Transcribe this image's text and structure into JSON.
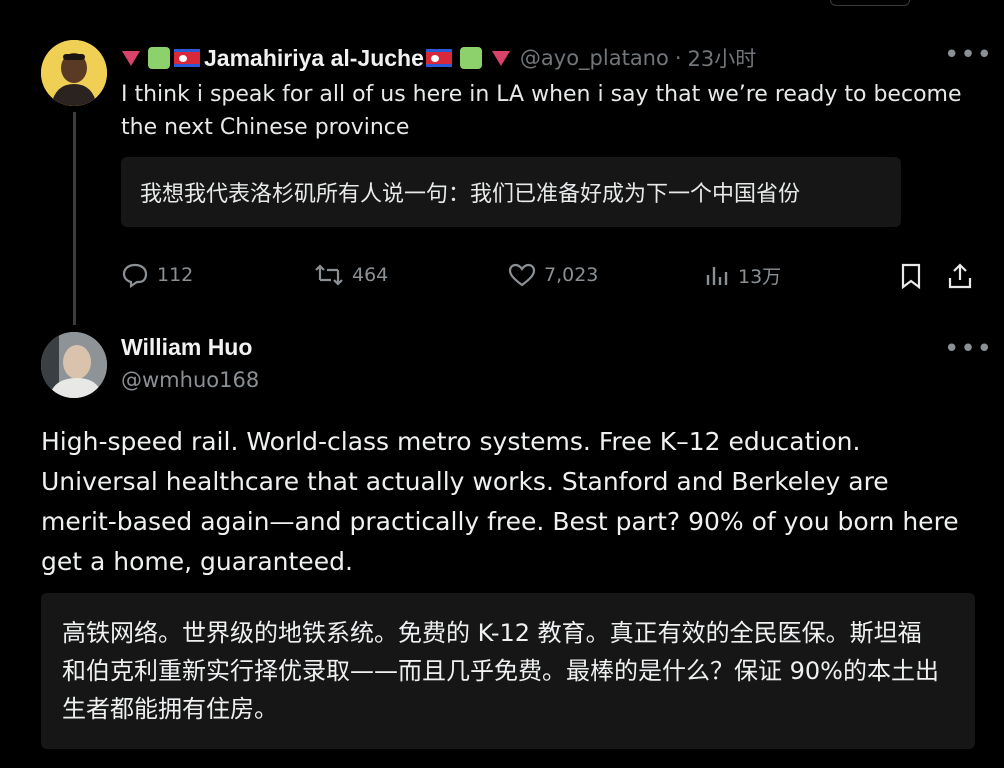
{
  "parent_tweet": {
    "display_name": "Jamahiriya al-Juche",
    "handle": "@ayo_platano",
    "time": "23小时",
    "separator": "·",
    "text": "I think i speak for all of us here in LA when i say that we’re ready to become the next Chinese province",
    "translation": "我想我代表洛杉矶所有人说一句：我们已准备好成为下一个中国省份",
    "actions": {
      "replies": "112",
      "retweets": "464",
      "likes": "7,023",
      "views": "13万"
    },
    "more_icon": "more-horizontal-icon",
    "accent_colors": {
      "triangle": "#d9436a",
      "square": "#8dd16c",
      "flag_red": "#d8283a",
      "flag_blue": "#2b5bd4"
    }
  },
  "reply_tweet": {
    "display_name": "William Huo",
    "handle": "@wmhuo168",
    "text": "High-speed rail. World-class metro systems. Free K–12 education. Universal healthcare that actually works. Stanford and Berkeley are merit-based again—and practically free. Best part? 90% of you born here get a home, guaranteed.",
    "translation": "高铁网络。世界级的地铁系统。免费的 K-12 教育。真正有效的全民医保。斯坦福和伯克利重新实行择优录取——而且几乎免费。最棒的是什么？保证 90%的本土出生者都能拥有住房。",
    "more_icon": "more-horizontal-icon"
  },
  "theme": {
    "background": "#000000",
    "text": "#e7e9ea",
    "muted": "#71767b",
    "translation_bg": "#161616"
  }
}
